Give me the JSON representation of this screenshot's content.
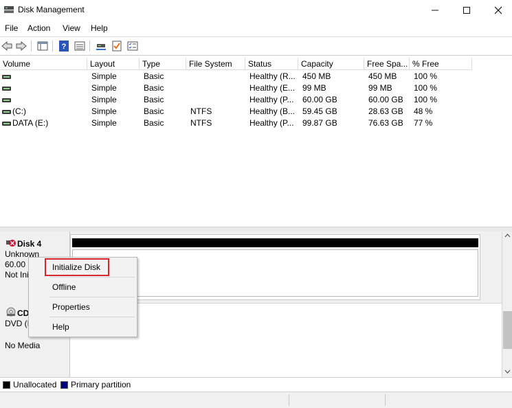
{
  "window": {
    "title": "Disk Management"
  },
  "menu": [
    "File",
    "Action",
    "View",
    "Help"
  ],
  "toolbar_icons": [
    "back-arrow-icon",
    "forward-arrow-icon",
    "console-tree-icon",
    "help-icon",
    "view-list-icon",
    "connect-icon",
    "checklist-icon",
    "properties-icon"
  ],
  "volume_table": {
    "headers": [
      "Volume",
      "Layout",
      "Type",
      "File System",
      "Status",
      "Capacity",
      "Free Spa...",
      "% Free"
    ],
    "rows": [
      {
        "volume": "",
        "layout": "Simple",
        "type": "Basic",
        "fs": "",
        "status": "Healthy (R...",
        "capacity": "450 MB",
        "free": "450 MB",
        "pct": "100 %"
      },
      {
        "volume": "",
        "layout": "Simple",
        "type": "Basic",
        "fs": "",
        "status": "Healthy (E...",
        "capacity": "99 MB",
        "free": "99 MB",
        "pct": "100 %"
      },
      {
        "volume": "",
        "layout": "Simple",
        "type": "Basic",
        "fs": "",
        "status": "Healthy (P...",
        "capacity": "60.00 GB",
        "free": "60.00 GB",
        "pct": "100 %"
      },
      {
        "volume": "(C:)",
        "layout": "Simple",
        "type": "Basic",
        "fs": "NTFS",
        "status": "Healthy (B...",
        "capacity": "59.45 GB",
        "free": "28.63 GB",
        "pct": "48 %"
      },
      {
        "volume": "DATA (E:)",
        "layout": "Simple",
        "type": "Basic",
        "fs": "NTFS",
        "status": "Healthy (P...",
        "capacity": "99.87 GB",
        "free": "76.63 GB",
        "pct": "77 %"
      }
    ]
  },
  "disks": [
    {
      "name": "Disk 4",
      "line1": "Unknown",
      "line2": "60.00 GB",
      "line3": "Not Initialized"
    },
    {
      "name": "CD-ROM 0",
      "line1": "DVD (D:)",
      "line2": "",
      "line3": "No Media"
    }
  ],
  "context_menu": {
    "items": [
      "Initialize Disk",
      "Offline",
      "Properties",
      "Help"
    ]
  },
  "legend": [
    {
      "label": "Unallocated",
      "color": "#000000"
    },
    {
      "label": "Primary partition",
      "color": "#000080"
    }
  ]
}
